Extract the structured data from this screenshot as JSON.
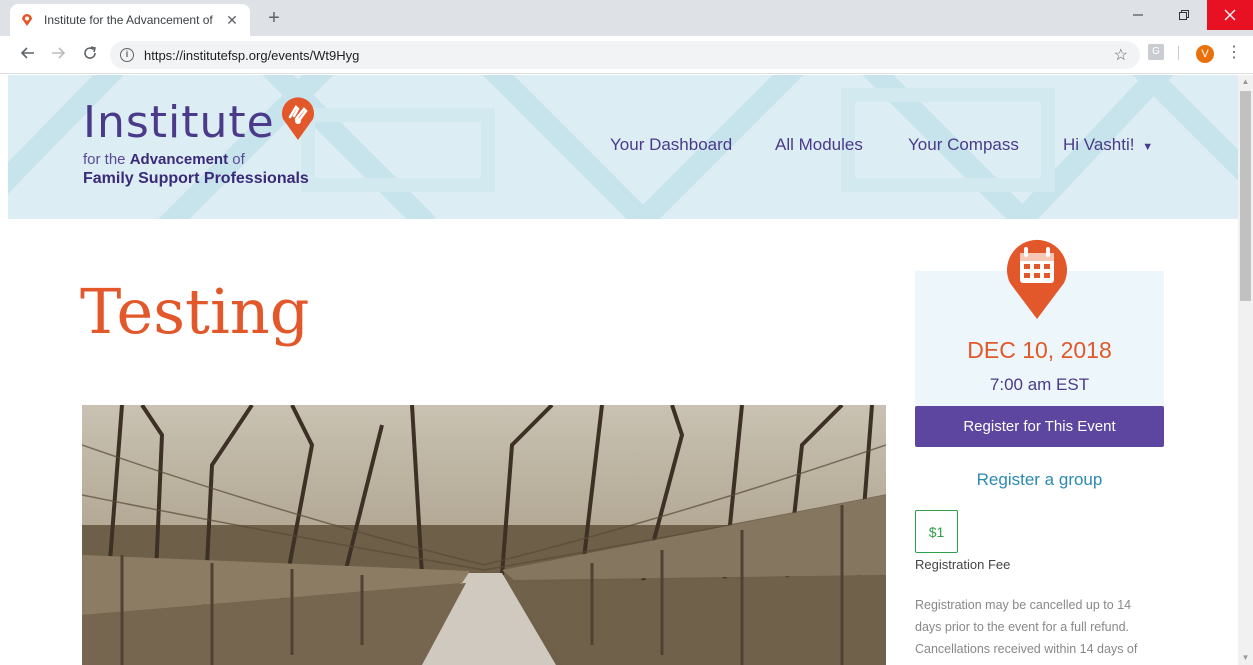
{
  "browser": {
    "tab_title": "Institute for the Advancement of",
    "tab_close": "✕",
    "new_tab": "+",
    "url": "https://institutefsp.org/events/Wt9Hyg",
    "ext_label": "G",
    "avatar_letter": "V"
  },
  "header": {
    "logo_main": "Institute",
    "logo_line2_pre": "for the ",
    "logo_line2_bold": "Advancement",
    "logo_line2_post": " of",
    "logo_line3": "Family Support Professionals",
    "nav": {
      "dashboard": "Your Dashboard",
      "modules": "All Modules",
      "compass": "Your Compass",
      "user": "Hi Vashti!"
    }
  },
  "event": {
    "title": "Testing",
    "date": "DEC 10, 2018",
    "time": "7:00 am EST",
    "register_button": "Register for This Event",
    "register_group": "Register a group",
    "fee": "$1",
    "fee_label": "Registration Fee",
    "policy_line1": "Registration may be cancelled up to 14",
    "policy_line2": "days prior to the event for a full refund.",
    "policy_line3": "Cancellations received within 14 days of"
  },
  "colors": {
    "brand_purple": "#4b3a8a",
    "accent_orange": "#e2582b",
    "button_purple": "#5d46a0",
    "link_blue": "#2b8ab3",
    "fee_green": "#2e9e4a"
  }
}
